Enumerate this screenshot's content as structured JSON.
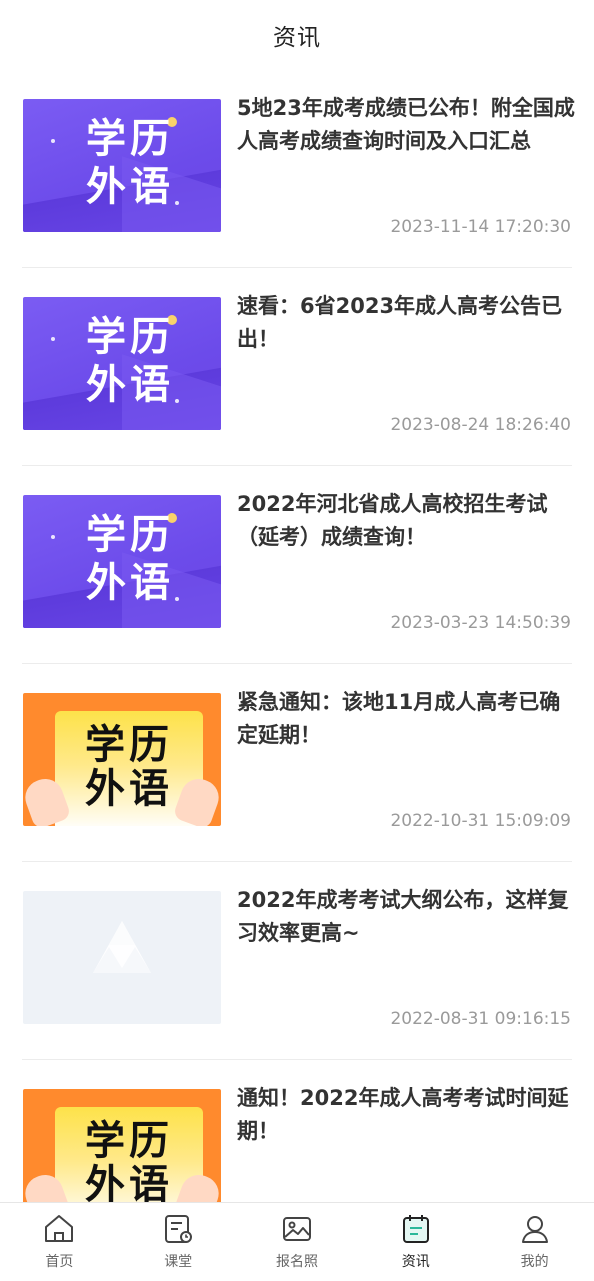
{
  "header": {
    "title": "资讯"
  },
  "thumbnails": {
    "line1": "学历",
    "line2": "外语"
  },
  "articles": [
    {
      "title": "5地23年成考成绩已公布！附全国成人高考成绩查询时间及入口汇总",
      "time": "2023-11-14 17:20:30",
      "thumb": "purple"
    },
    {
      "title": "速看：6省2023年成人高考公告已出！",
      "time": "2023-08-24 18:26:40",
      "thumb": "purple"
    },
    {
      "title": "2022年河北省成人高校招生考试（延考）成绩查询！",
      "time": "2023-03-23 14:50:39",
      "thumb": "purple"
    },
    {
      "title": "紧急通知：该地11月成人高考已确定延期！",
      "time": "2022-10-31 15:09:09",
      "thumb": "orange"
    },
    {
      "title": "2022年成考考试大纲公布，这样复习效率更高~",
      "time": "2022-08-31 09:16:15",
      "thumb": "placeholder"
    },
    {
      "title": "通知！2022年成人高考考试时间延期！",
      "time": "",
      "thumb": "orange"
    }
  ],
  "tabbar": {
    "items": [
      {
        "label": "首页",
        "icon": "home-icon"
      },
      {
        "label": "课堂",
        "icon": "classroom-icon"
      },
      {
        "label": "报名照",
        "icon": "photo-icon"
      },
      {
        "label": "资讯",
        "icon": "news-icon",
        "active": true
      },
      {
        "label": "我的",
        "icon": "profile-icon"
      }
    ]
  },
  "colors": {
    "accent": "#7b5cf3",
    "orange": "#ff8a2d",
    "tab_active": "#222222"
  }
}
